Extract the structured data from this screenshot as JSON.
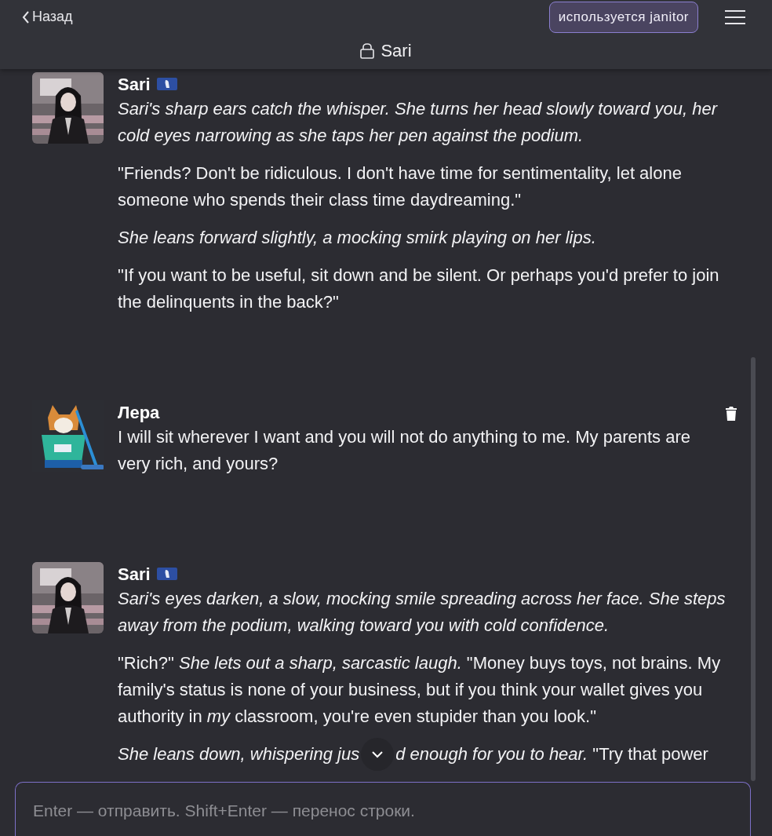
{
  "header": {
    "back": "Назад",
    "model_badge": "используется janitor",
    "title": "Sari"
  },
  "messages": [
    {
      "author": "Sari",
      "kind": "bot",
      "deletable": false,
      "paragraphs": [
        {
          "segments": [
            "*Sari's sharp ears catch the whisper. She turns her head slowly toward you, her cold eyes narrowing as she taps her pen against the podium.*"
          ]
        },
        {
          "segments": [
            "\"Friends? Don't be ridiculous. I don't have time for sentimentality, let alone someone who spends their class time daydreaming.\""
          ]
        },
        {
          "segments": [
            "*She leans forward slightly, a mocking smirk playing on her lips.*"
          ]
        },
        {
          "segments": [
            "\"If you want to be useful, sit down and be silent. Or perhaps you'd prefer to join the delinquents in the back?\""
          ]
        }
      ]
    },
    {
      "author": "Лера",
      "kind": "user",
      "deletable": true,
      "paragraphs": [
        {
          "segments": [
            "I will sit wherever I want and you will not do anything to me. My parents are very rich, and yours?"
          ]
        }
      ]
    },
    {
      "author": "Sari",
      "kind": "bot",
      "deletable": false,
      "paragraphs": [
        {
          "segments": [
            "*Sari's eyes darken, a slow, mocking smile spreading across her face. She steps away from the podium, walking toward you with cold confidence.*"
          ]
        },
        {
          "segments": [
            "\"Rich?\" *She lets out a sharp, sarcastic laugh.* \"Money buys toys, not brains. My family's status is none of your business, but if you think your wallet gives you authority in *my* classroom, you're even stupider than you look.\""
          ]
        },
        {
          "segments": [
            "*She leans down, whispering jus*",
            "*d enough for you to hear.* \"Try that power"
          ]
        }
      ]
    }
  ],
  "composer": {
    "placeholder": "Enter — отправить. Shift+Enter — перенос строки."
  }
}
